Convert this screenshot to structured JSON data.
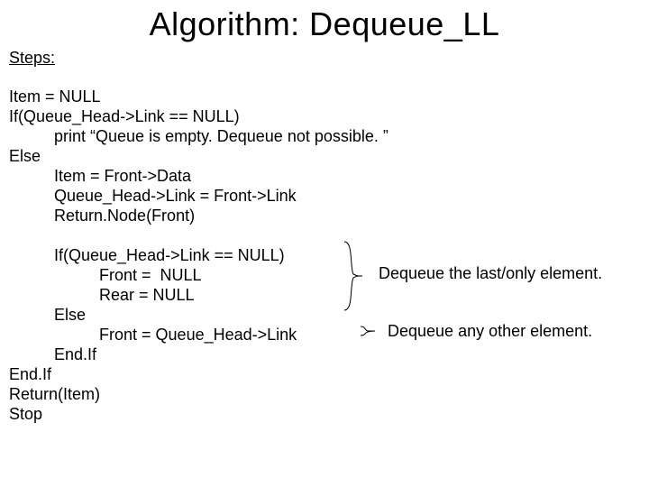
{
  "title": "Algorithm: Dequeue_LL",
  "steps_label": "Steps:",
  "code": {
    "l1": "Item = NULL",
    "l2": "If(Queue_Head->Link == NULL)",
    "l3": "          print “Queue is empty. Dequeue not possible. ”",
    "l4": "Else",
    "l5": "          Item = Front->Data",
    "l6": "          Queue_Head->Link = Front->Link",
    "l7": "          Return.Node(Front)",
    "l8": "",
    "l9": "          If(Queue_Head->Link == NULL)",
    "l10": "                    Front =  NULL",
    "l11": "                    Rear = NULL",
    "l12": "          Else",
    "l13": "                    Front = Queue_Head->Link",
    "l14": "          End.If",
    "l15": "End.If",
    "l16": "Return(Item)",
    "l17": "Stop"
  },
  "annotations": {
    "a1": "Dequeue the last/only element.",
    "a2": "Dequeue any other element."
  }
}
